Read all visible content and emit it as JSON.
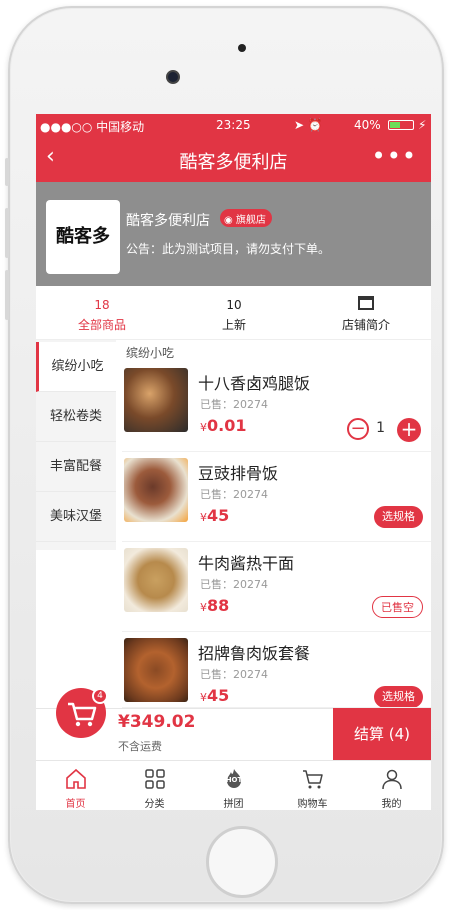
{
  "status_bar": {
    "carrier": "●●●○○ 中国移动",
    "time": "23:25",
    "battery": "40%"
  },
  "nav": {
    "back": "‹",
    "title": "酷客多便利店",
    "more": "•••"
  },
  "store": {
    "logo_text": "酷客多",
    "name": "酷客多便利店",
    "flag": "旗舰店",
    "notice": "公告：此为测试项目，请勿支付下单。"
  },
  "top_tabs": [
    {
      "num": "18",
      "label": "全部商品"
    },
    {
      "num": "10",
      "label": "上新"
    },
    {
      "label": "店铺简介"
    }
  ],
  "sidebar": {
    "items": [
      {
        "label": "缤纷小吃"
      },
      {
        "label": "轻松卷类"
      },
      {
        "label": "丰富配餐"
      },
      {
        "label": "美味汉堡"
      }
    ]
  },
  "category_title": "缤纷小吃",
  "products": [
    {
      "name": "十八香卤鸡腿饭",
      "sold": "已售：20274",
      "currency": "¥",
      "price": "0.01",
      "qty": "1"
    },
    {
      "name": "豆豉排骨饭",
      "sold": "已售：20274",
      "currency": "¥",
      "price": "45",
      "action": "选规格"
    },
    {
      "name": "牛肉酱热干面",
      "sold": "已售：20274",
      "currency": "¥",
      "price": "88",
      "action": "已售空"
    },
    {
      "name": "招牌鲁肉饭套餐",
      "sold": "已售：20274",
      "currency": "¥",
      "price": "45",
      "action": "选规格"
    }
  ],
  "cart": {
    "badge": "4",
    "total": "¥349.02",
    "shipping": "不含运费",
    "checkout": "结算 (4)"
  },
  "bottom_nav": [
    {
      "label": "首页"
    },
    {
      "label": "分类"
    },
    {
      "label": "拼团",
      "badge": "HOT"
    },
    {
      "label": "购物车"
    },
    {
      "label": "我的"
    }
  ],
  "colors": {
    "accent": "#e13544",
    "banner": "#8e8e8e"
  }
}
